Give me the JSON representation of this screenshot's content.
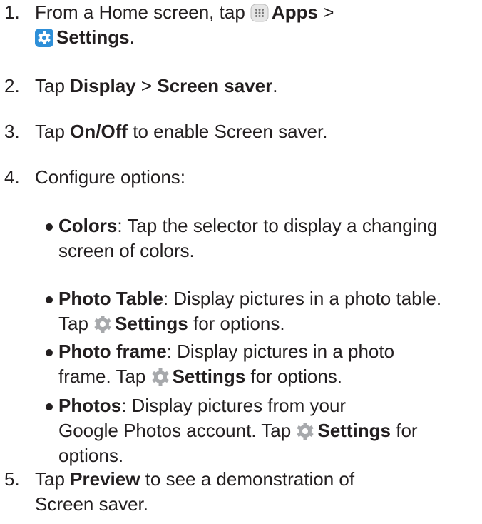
{
  "steps": [
    {
      "number": "1.",
      "parts": [
        "From a Home screen, tap",
        "Apps",
        ">",
        "Settings",
        "."
      ]
    },
    {
      "number": "2.",
      "parts": [
        "Tap",
        "Display",
        ">",
        "Screen saver",
        "."
      ]
    },
    {
      "number": "3.",
      "parts": [
        "Tap",
        "On/Off",
        "to enable Screen saver."
      ]
    },
    {
      "number": "4.",
      "parts": [
        "Configure options:"
      ]
    },
    {
      "number": "5.",
      "parts": [
        "Tap",
        "Preview",
        "to see a demonstration of",
        "Screen saver."
      ]
    }
  ],
  "options": [
    {
      "name": "Colors",
      "desc_1": ": Tap the selector to display a changing",
      "desc_2": "screen of colors."
    },
    {
      "name": "Photo Table",
      "desc_1": ": Display pictures in a photo table.",
      "desc_2": "Tap",
      "settings": "Settings",
      "desc_3": "for options."
    },
    {
      "name": "Photo frame",
      "desc_1": ": Display pictures in a photo",
      "desc_2": "frame. Tap",
      "settings": "Settings",
      "desc_3": "for options."
    },
    {
      "name": "Photos",
      "desc_1": ": Display pictures from your",
      "desc_2": "Google Photos account. Tap",
      "settings": "Settings",
      "desc_3": "for",
      "desc_4": "options."
    }
  ],
  "icons": {
    "apps": "apps-grid-icon",
    "settings_blue": "settings-gear-icon",
    "settings_gray": "settings-gear-icon",
    "colors": {
      "gray_gear": "#a7a9ac",
      "blue_gear": "#2e8fd8",
      "apps_bg": "#e6e6e6"
    }
  }
}
